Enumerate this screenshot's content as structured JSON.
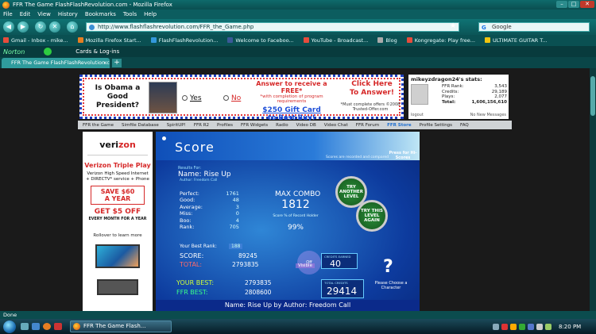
{
  "window": {
    "title": "FFR The Game FlashFlashRevolution.com - Mozilla Firefox",
    "controls": [
      "–",
      "□",
      "✕"
    ]
  },
  "menu": [
    "File",
    "Edit",
    "View",
    "History",
    "Bookmarks",
    "Tools",
    "Help"
  ],
  "nav": {
    "url": "http://www.flashflashrevolution.com/FFR_the_Game.php",
    "search_placeholder": "Google"
  },
  "bookmarks": [
    "Gmail - Inbox - mike...",
    "Mozilla Firefox Start...",
    "FlashFlashRevolution...",
    "Welcome to Faceboo...",
    "YouTube - Broadcast...",
    "Blog",
    "Kongregate: Play free...",
    "ULTIMATE GUITAR T..."
  ],
  "norton": {
    "label": "Norton",
    "cards": "Cards & Log-ins"
  },
  "tab": {
    "label": "FFR The Game FlashFlashRevolution.co...",
    "close": "×",
    "new": "+"
  },
  "ad": {
    "question": "Is Obama a Good President?",
    "yes": "Yes",
    "no": "No",
    "offer_line1": "Answer to receive a FREE*",
    "offer_line2": "*with completion of program requirements",
    "offer_line3": "$250 Gift Card",
    "offer_line4": "to Best Buy!",
    "click": "Click Here To Answer!",
    "fine": "*Must complete offers ©2008 Trusted-Offer.com"
  },
  "stats": {
    "heading": "mikeyzdragon24's stats:",
    "rows": [
      {
        "label": "FFR Rank:",
        "value": "3,543"
      },
      {
        "label": "Credits:",
        "value": "29,189"
      },
      {
        "label": "Plays:",
        "value": "2,077"
      },
      {
        "label": "Total:",
        "value": "1,606,156,610"
      }
    ],
    "logout": "logout",
    "messages": "No New Messages"
  },
  "sitenav": [
    "FFR the Game",
    "Simfile Database",
    "SpiritUP!",
    "FFR R2",
    "Profiles",
    "FFR Widgets",
    "Radio",
    "Video DB",
    "Video Chat",
    "FFR Forum",
    "FFR Store",
    "Profile Settings",
    "FAQ"
  ],
  "sidead": {
    "logo_main": "veri",
    "logo_accent": "zon",
    "triple": "Verizon Triple Play",
    "hs1": "Verizon High Speed Internet",
    "hs2": "+ DIRECTV* service + Phone",
    "save1": "SAVE $60",
    "save2": "A YEAR",
    "getoff": "GET $5 OFF",
    "every": "EVERY MONTH FOR A YEAR",
    "rollover": "Rollover to learn more"
  },
  "game": {
    "title": "Score",
    "press": "Press for Hi-Scores",
    "recorded": "Scores are recorded and compared",
    "results_for": "Results For:",
    "song": "Name: Rise Up",
    "author": "Author: Freedom Call",
    "judgements": [
      {
        "label": "Perfect:",
        "value": "1761"
      },
      {
        "label": "Good:",
        "value": "48"
      },
      {
        "label": "Average:",
        "value": "3"
      },
      {
        "label": "Miss:",
        "value": "0"
      },
      {
        "label": "Boo:",
        "value": "4"
      },
      {
        "label": "Rank:",
        "value": "705"
      }
    ],
    "max_combo_label": "MAX COMBO",
    "max_combo": "1812",
    "score_pct_label": "Score % of Record Holder",
    "score_pct": "99%",
    "try_another": "TRY ANOTHER LEVEL",
    "try_again": "TRY THIS LEVEL AGAIN",
    "best_rank_label": "Your Best Rank:",
    "best_rank": "188",
    "score_label": "SCORE:",
    "score": "89245",
    "total_label": "TOTAL:",
    "total": "2793835",
    "diff": "Off",
    "visible": "Visible",
    "credits_label": "CREDITS EARNED",
    "credits": "40",
    "choose": "Please Choose a Character",
    "your_best_label": "YOUR BEST:",
    "your_best": "2793835",
    "ffr_best_label": "FFR BEST:",
    "ffr_best": "2808600",
    "total_credits_label": "TOTAL CREDITS",
    "total_credits": "29414",
    "footer": "Name: Rise Up by Author: Freedom Call"
  },
  "status": "Done",
  "taskbar": {
    "window": "FFR The Game Flash...",
    "clock": "8:20 PM"
  }
}
